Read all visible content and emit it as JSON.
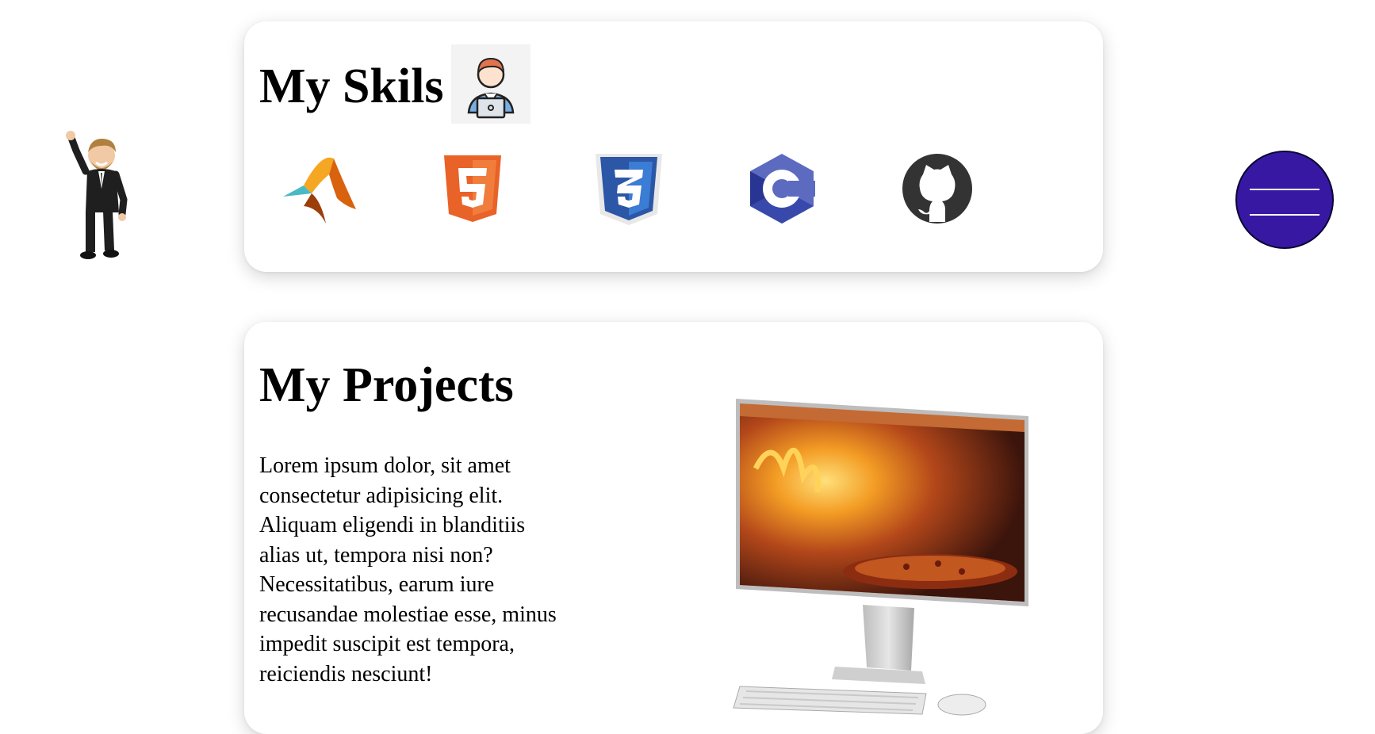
{
  "skills": {
    "title": "My Skils",
    "badge_icon": "developer-at-laptop-icon",
    "items": [
      {
        "name": "MATLAB",
        "icon": "matlab-icon",
        "color": "#e66b12"
      },
      {
        "name": "HTML5",
        "icon": "html5-icon",
        "color": "#e96228"
      },
      {
        "name": "CSS3",
        "icon": "css3-icon",
        "color": "#2c56a6"
      },
      {
        "name": "C",
        "icon": "c-language-icon",
        "color": "#3f51b5"
      },
      {
        "name": "GitHub",
        "icon": "github-icon",
        "color": "#333333"
      }
    ]
  },
  "projects": {
    "title": "My Projects",
    "description": "Lorem ipsum dolor, sit amet consectetur adipisicing elit. Aliquam eligendi in blanditiis alias ut, tempora nisi non? Necessitatibus, earum iure recusandae molestiae esse, minus impedit suscipit est tempora, reiciendis nesciunt!",
    "image_icon": "desktop-computer-pizza-oven-icon"
  },
  "menu": {
    "icon": "hamburger-menu-icon",
    "color": "#3718a3"
  },
  "avatar": {
    "icon": "waving-cartoon-man-icon"
  }
}
